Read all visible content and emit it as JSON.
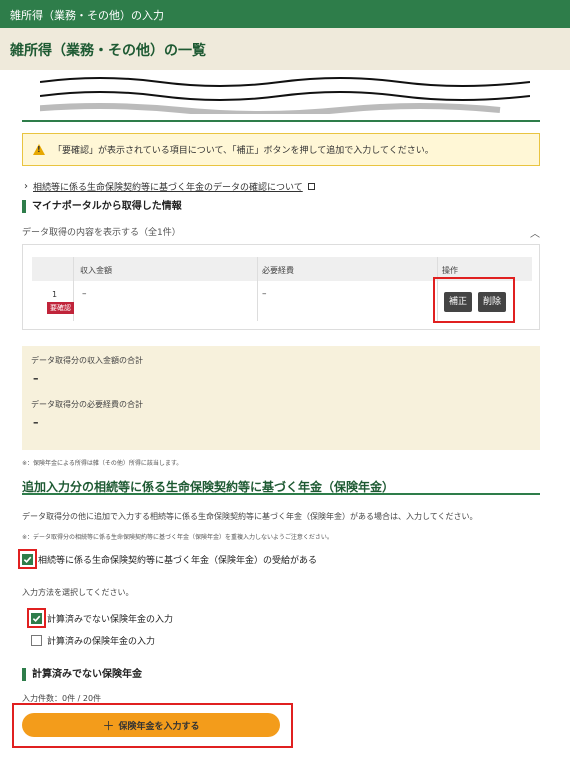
{
  "topbar": {
    "title": "雑所得（業務・その他）の入力"
  },
  "page": {
    "title": "雑所得（業務・その他）の一覧"
  },
  "warning": {
    "text": "「要確認」が表示されている項目について、「補正」ボタンを押して追加で入力してください。"
  },
  "confirm_link": {
    "text": "相続等に係る生命保険契約等に基づく年金のデータの確認について"
  },
  "mynaportal": {
    "heading": "マイナポータルから取得した情報",
    "accordion_label": "データ取得の内容を表示する（全1件）",
    "table": {
      "headers": [
        "収入金額",
        "必要経費",
        "操作"
      ],
      "rows": [
        {
          "num": "1",
          "badge": "要確認",
          "income": "–",
          "expense": "–",
          "fix_label": "補正",
          "delete_label": "削除"
        }
      ]
    }
  },
  "summary": {
    "income_label": "データ取得分の収入金額の合計",
    "income_value": "–",
    "expense_label": "データ取得分の必要経費の合計",
    "expense_value": "–"
  },
  "note1": "※：保険年金による所得は雑（その他）所得に該当します。",
  "manual": {
    "heading": "追加入力分の相続等に係る生命保険契約等に基づく年金（保険年金）",
    "desc": "データ取得分の他に追加で入力する相続等に係る生命保険契約等に基づく年金（保険年金）がある場合は、入力してください。",
    "note": "※：データ取得分の相続等に係る生命保険契約等に基づく年金（保険年金）を重複入力しないようご注意ください。",
    "received_checkbox": "相続等に係る生命保険契約等に基づく年金（保険年金）の受給がある",
    "method_prompt": "入力方法を選択してください。",
    "option_uncalc": "計算済みでない保険年金の入力",
    "option_calc": "計算済みの保険年金の入力",
    "uncalc_heading": "計算済みでない保険年金",
    "count_text": "入力件数：0件 / 20件",
    "add_button": "保険年金を入力する"
  },
  "colors": {
    "brand_green": "#2e7d4a",
    "accent_orange": "#f39c1b",
    "highlight_red": "#e02020",
    "badge_red": "#c0243a"
  }
}
